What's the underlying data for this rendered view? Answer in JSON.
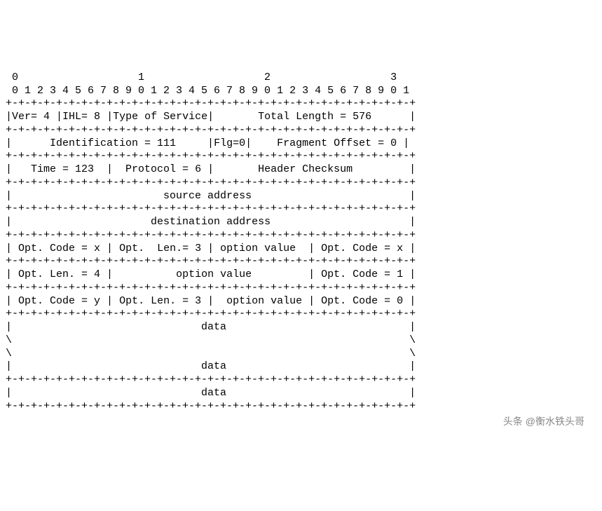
{
  "ruler": {
    "tens": " 0                   1                   2                   3",
    "ones": " 0 1 2 3 4 5 6 7 8 9 0 1 2 3 4 5 6 7 8 9 0 1 2 3 4 5 6 7 8 9 0 1"
  },
  "sep": "+-+-+-+-+-+-+-+-+-+-+-+-+-+-+-+-+-+-+-+-+-+-+-+-+-+-+-+-+-+-+-+-+",
  "header": {
    "row1": {
      "ver": "Ver= 4",
      "ihl": "IHL= 8",
      "tos": "Type of Service",
      "total_length": "Total Length = 576"
    },
    "row2": {
      "identification": "Identification = 111",
      "flags": "Flg=0",
      "frag_offset": "Fragment Offset = 0"
    },
    "row3": {
      "ttl": "Time = 123",
      "protocol": "Protocol = 6",
      "checksum": "Header Checksum"
    },
    "row4": {
      "source": "source address"
    },
    "row5": {
      "dest": "destination address"
    }
  },
  "options": {
    "row1": {
      "a": "Opt. Code = x",
      "b": "Opt.  Len.= 3",
      "c": "option value",
      "d": "Opt. Code = x"
    },
    "row2": {
      "a": "Opt. Len. = 4",
      "b": "option value",
      "c": "Opt. Code = 1"
    },
    "row3": {
      "a": "Opt. Code = y",
      "b": "Opt. Len. = 3",
      "c": "option value",
      "d": "Opt. Code = 0"
    }
  },
  "data": {
    "label": "data",
    "open_top": "|                                                               |",
    "slash": "\\                                                               \\",
    "mid": "|                              data                             |"
  },
  "watermark": "头条 @衡水铁头哥"
}
